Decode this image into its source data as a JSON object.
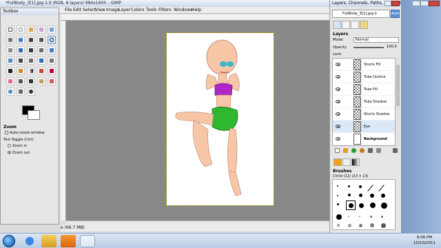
{
  "main_window": {
    "title": "*FullBody_3[1].jpg-1.0 (RGB, 8 layers) 984x1600 – GIMP",
    "menus": [
      "File",
      "Edit",
      "Select",
      "View",
      "Image",
      "Layer",
      "Colors",
      "Tools",
      "Filters",
      "Windows",
      "Help"
    ]
  },
  "toolbox": {
    "title": "Toolbox",
    "options_title": "Zoom",
    "auto_resize": "Auto-resize window",
    "tool_toggle": "Tool Toggle  (Ctrl)",
    "zoom_in": "Zoom in",
    "zoom_out": "Zoom out"
  },
  "status": {
    "text": "e (66.7 MB)"
  },
  "dock": {
    "title": "Layers, Channels, Paths, Undo – Br...",
    "image_select": "FullBody_3[1].jpg-1",
    "auto_label": "Auto",
    "layers_label": "Layers",
    "mode_label": "Mode:",
    "mode_value": "Normal",
    "opacity_label": "Opacity",
    "opacity_value": "100.0",
    "lock_label": "Lock:",
    "layers": [
      {
        "name": "Shorts Fill"
      },
      {
        "name": "Tube Outline"
      },
      {
        "name": "Tube Fill"
      },
      {
        "name": "Tube Shadow"
      },
      {
        "name": "Shorts Shadow"
      },
      {
        "name": "Eye"
      },
      {
        "name": "Background"
      }
    ],
    "brushes_label": "Brushes",
    "brush_name": "Circle (11) (13 × 13)"
  },
  "taskbar": {
    "time": "9:06 PM",
    "date": "10/10/2011"
  },
  "colors": {
    "titlebar": "#c9d8ea",
    "taskbar": "#b9cce4",
    "canvas_bg": "#888888",
    "purple_top": "#b026c9",
    "green_shorts": "#2fb82f",
    "skin": "#f7c6a6"
  }
}
